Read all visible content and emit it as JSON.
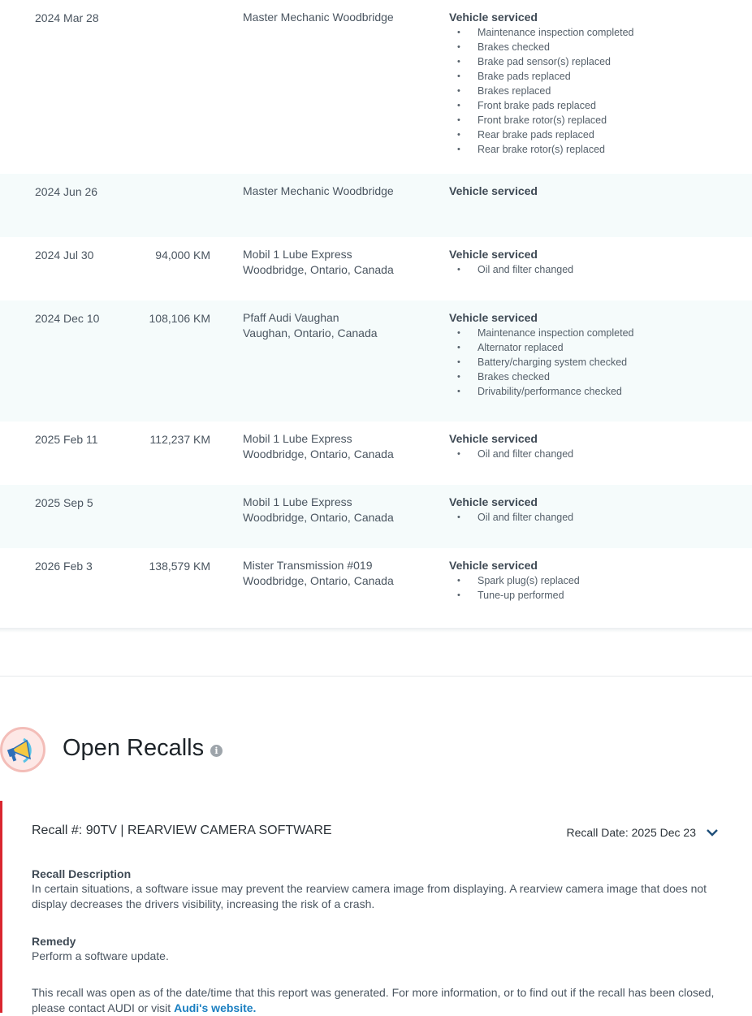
{
  "service_history": [
    {
      "date": "2024 Mar 28",
      "km": "",
      "source": [
        "Master Mechanic Woodbridge"
      ],
      "title": "Vehicle serviced",
      "items": [
        "Maintenance inspection completed",
        "Brakes checked",
        "Brake pad sensor(s) replaced",
        "Brake pads replaced",
        "Brakes replaced",
        "Front brake pads replaced",
        "Front brake rotor(s) replaced",
        "Rear brake pads replaced",
        "Rear brake rotor(s) replaced"
      ]
    },
    {
      "date": "2024 Jun 26",
      "km": "",
      "source": [
        "Master Mechanic Woodbridge"
      ],
      "title": "Vehicle serviced",
      "items": []
    },
    {
      "date": "2024 Jul 30",
      "km": "94,000 KM",
      "source": [
        "Mobil 1 Lube Express",
        "Woodbridge, Ontario, Canada"
      ],
      "title": "Vehicle serviced",
      "items": [
        "Oil and filter changed"
      ]
    },
    {
      "date": "2024 Dec 10",
      "km": "108,106 KM",
      "source": [
        "Pfaff Audi Vaughan",
        "Vaughan, Ontario, Canada"
      ],
      "title": "Vehicle serviced",
      "items": [
        "Maintenance inspection completed",
        "Alternator replaced",
        "Battery/charging system checked",
        "Brakes checked",
        "Drivability/performance checked"
      ]
    },
    {
      "date": "2025 Feb 11",
      "km": "112,237 KM",
      "source": [
        "Mobil 1 Lube Express",
        "Woodbridge, Ontario, Canada"
      ],
      "title": "Vehicle serviced",
      "items": [
        "Oil and filter changed"
      ]
    },
    {
      "date": "2025 Sep 5",
      "km": "",
      "source": [
        "Mobil 1 Lube Express",
        "Woodbridge, Ontario, Canada"
      ],
      "title": "Vehicle serviced",
      "items": [
        "Oil and filter changed"
      ]
    },
    {
      "date": "2026 Feb 3",
      "km": "138,579 KM",
      "source": [
        "Mister Transmission #019",
        "Woodbridge, Ontario, Canada"
      ],
      "title": "Vehicle serviced",
      "items": [
        "Spark plug(s) replaced",
        "Tune-up performed"
      ]
    }
  ],
  "recalls": {
    "title": "Open Recalls",
    "info_icon": "i",
    "recall_title": "Recall #: 90TV | REARVIEW CAMERA SOFTWARE",
    "recall_date": "Recall Date: 2025 Dec 23",
    "description_label": "Recall Description",
    "description": "In certain situations, a software issue may prevent the rearview camera image from displaying. A rearview camera image that does not display decreases the drivers visibility, increasing the risk of a crash.",
    "remedy_label": "Remedy",
    "remedy": "Perform a software update.",
    "note": "This recall was open as of the date/time that this report was generated. For more information, or to find out if the recall has been closed, please contact AUDI or visit ",
    "link_text": "Audi's website."
  },
  "colors": {
    "accent_red": "#d9262f",
    "link_blue": "#1a7fc1",
    "row_alt": "#f5fbfb"
  }
}
